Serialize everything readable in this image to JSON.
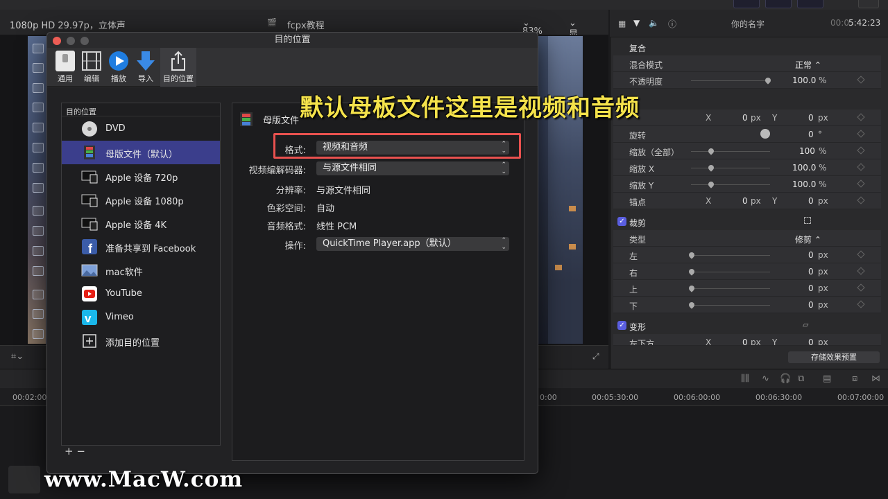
{
  "viewer_header": {
    "format_info": "1080p HD 29.97p，立体声",
    "project": "fcpx教程",
    "zoom": "83%",
    "display_menu": "显示"
  },
  "inspector": {
    "title": "你的名字",
    "timecode_prefix": "00:0",
    "timecode": "5:42:23",
    "composite_section": "复合",
    "blend_mode_label": "混合模式",
    "blend_mode_value": "正常",
    "opacity_label": "不透明度",
    "opacity_value": "100.0",
    "rotation_label": "旋转",
    "rotation_value": "0",
    "rotation_unit": "°",
    "scale_all_label": "缩放（全部）",
    "scale_all_value": "100",
    "scale_x_label": "缩放 X",
    "scale_x_value": "100.0",
    "scale_y_label": "缩放 Y",
    "scale_y_value": "100.0",
    "anchor_label": "锚点",
    "anchor_x": "0",
    "anchor_y": "0",
    "position_x": "0",
    "position_y": "0",
    "crop_section": "裁剪",
    "crop_type_label": "类型",
    "crop_type_value": "修剪",
    "left_label": "左",
    "right_label": "右",
    "top_label": "上",
    "bottom_label": "下",
    "crop_value": "0",
    "distort_section": "变形",
    "bottom_left_label": "左下方",
    "bl_x": "0",
    "bl_y": "0",
    "unit_px": "px",
    "unit_pct": "%",
    "x_label": "X",
    "y_label": "Y",
    "save_preset": "存储效果预置"
  },
  "timeline": {
    "ruler": [
      "00:02:00",
      "0:00",
      "00:05:30:00",
      "00:06:00:00",
      "00:06:30:00",
      "00:07:00:00"
    ]
  },
  "dialog": {
    "title": "目的位置",
    "toolbar": [
      {
        "label": "通用",
        "icon": "switch-icon"
      },
      {
        "label": "编辑",
        "icon": "film-icon"
      },
      {
        "label": "播放",
        "icon": "play-icon"
      },
      {
        "label": "导入",
        "icon": "download-arrow-icon"
      },
      {
        "label": "目的位置",
        "icon": "share-icon"
      }
    ],
    "destinations_header": "目的位置",
    "destinations": [
      {
        "label": "DVD",
        "icon": "dvd-icon"
      },
      {
        "label": "母版文件（默认）",
        "icon": "master-file-icon"
      },
      {
        "label": "Apple 设备 720p",
        "icon": "apple-devices-icon"
      },
      {
        "label": "Apple 设备 1080p",
        "icon": "apple-devices-icon"
      },
      {
        "label": "Apple 设备 4K",
        "icon": "apple-devices-icon"
      },
      {
        "label": "准备共享到 Facebook",
        "icon": "facebook-icon"
      },
      {
        "label": "mac软件",
        "icon": "image-icon"
      },
      {
        "label": "YouTube",
        "icon": "youtube-icon"
      },
      {
        "label": "Vimeo",
        "icon": "vimeo-icon"
      },
      {
        "label": "添加目的位置",
        "icon": "add-icon"
      }
    ],
    "selected_index": 1,
    "footer_buttons": "+ −",
    "detail": {
      "name": "母版文件",
      "format_label": "格式:",
      "format_value": "视频和音频",
      "codec_label": "视频编解码器:",
      "codec_value": "与源文件相同",
      "resolution_label": "分辨率:",
      "resolution_value": "与源文件相同",
      "colorspace_label": "色彩空间:",
      "colorspace_value": "自动",
      "audio_format_label": "音频格式:",
      "audio_format_value": "线性 PCM",
      "action_label": "操作:",
      "action_value": "QuickTime Player.app（默认）"
    }
  },
  "overlay": {
    "caption": "默认母板文件这里是视频和音频",
    "watermark": "www.MacW.com"
  },
  "colors": {
    "selection": "#3b3e8c",
    "highlight_box": "#e9514f",
    "caption": "#f4e24b"
  }
}
